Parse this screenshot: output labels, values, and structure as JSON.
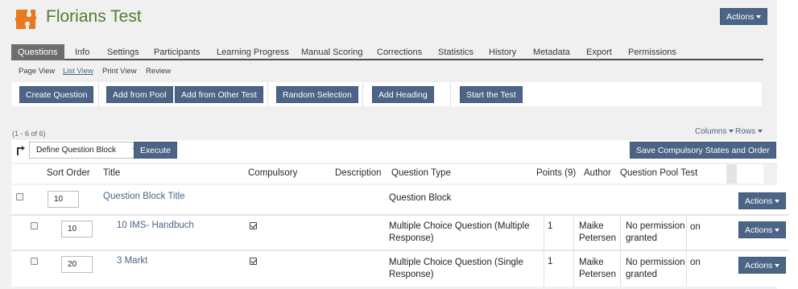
{
  "header": {
    "title": "Florians Test",
    "actions_label": "Actions"
  },
  "tabs": [
    {
      "label": "Questions",
      "active": true
    },
    {
      "label": "Info"
    },
    {
      "label": "Settings"
    },
    {
      "label": "Participants"
    },
    {
      "label": "Learning Progress"
    },
    {
      "label": "Manual Scoring"
    },
    {
      "label": "Corrections"
    },
    {
      "label": "Statistics"
    },
    {
      "label": "History"
    },
    {
      "label": "Metadata"
    },
    {
      "label": "Export"
    },
    {
      "label": "Permissions"
    }
  ],
  "subtabs": [
    {
      "label": "Page View"
    },
    {
      "label": "List View",
      "active": true
    },
    {
      "label": "Print View"
    },
    {
      "label": "Review"
    }
  ],
  "toolbar": {
    "create_question": "Create Question",
    "add_from_pool": "Add from Pool",
    "add_from_other_test": "Add from Other Test",
    "random_selection": "Random Selection",
    "add_heading": "Add Heading",
    "start_test": "Start the Test"
  },
  "table_controls": {
    "count": "(1 - 6 of 6)",
    "columns": "Columns",
    "rows": "Rows",
    "command_select": "Define Question Block",
    "execute": "Execute",
    "save_compulsory": "Save Compulsory States and Order"
  },
  "columns": [
    "Sort Order",
    "Title",
    "Compulsory",
    "Description",
    "Question Type",
    "Points (9)",
    "Author",
    "Question Pool Test"
  ],
  "rows": [
    {
      "sort_order": "10",
      "title": "Question Block Title",
      "compulsory": null,
      "type_line1": "Question Block",
      "type_line2": "",
      "points": "",
      "author_line1": "",
      "author_line2": "",
      "pool_line1": "",
      "pool_line2": "",
      "pool_extra": "",
      "actions": "Actions"
    },
    {
      "sort_order": "10",
      "title": "10 IMS- Handbuch",
      "compulsory": true,
      "type_line1": "Multiple Choice Question (Multiple",
      "type_line2": "Response)",
      "points": "1",
      "author_line1": "Maike",
      "author_line2": "Petersen",
      "pool_line1": "No permission",
      "pool_line2": "granted",
      "pool_extra": "on",
      "actions": "Actions"
    },
    {
      "sort_order": "20",
      "title": "3 Markt",
      "compulsory": true,
      "type_line1": "Multiple Choice Question (Single",
      "type_line2": "Response)",
      "points": "1",
      "author_line1": "Maike",
      "author_line2": "Petersen",
      "pool_line1": "No permission",
      "pool_line2": "granted",
      "pool_extra": "on",
      "actions": "Actions"
    }
  ],
  "colors": {
    "primary_button": "#4c6586",
    "title_green": "#557b2e",
    "logo_orange": "#e8791e",
    "active_tab": "#6d6d6d"
  }
}
